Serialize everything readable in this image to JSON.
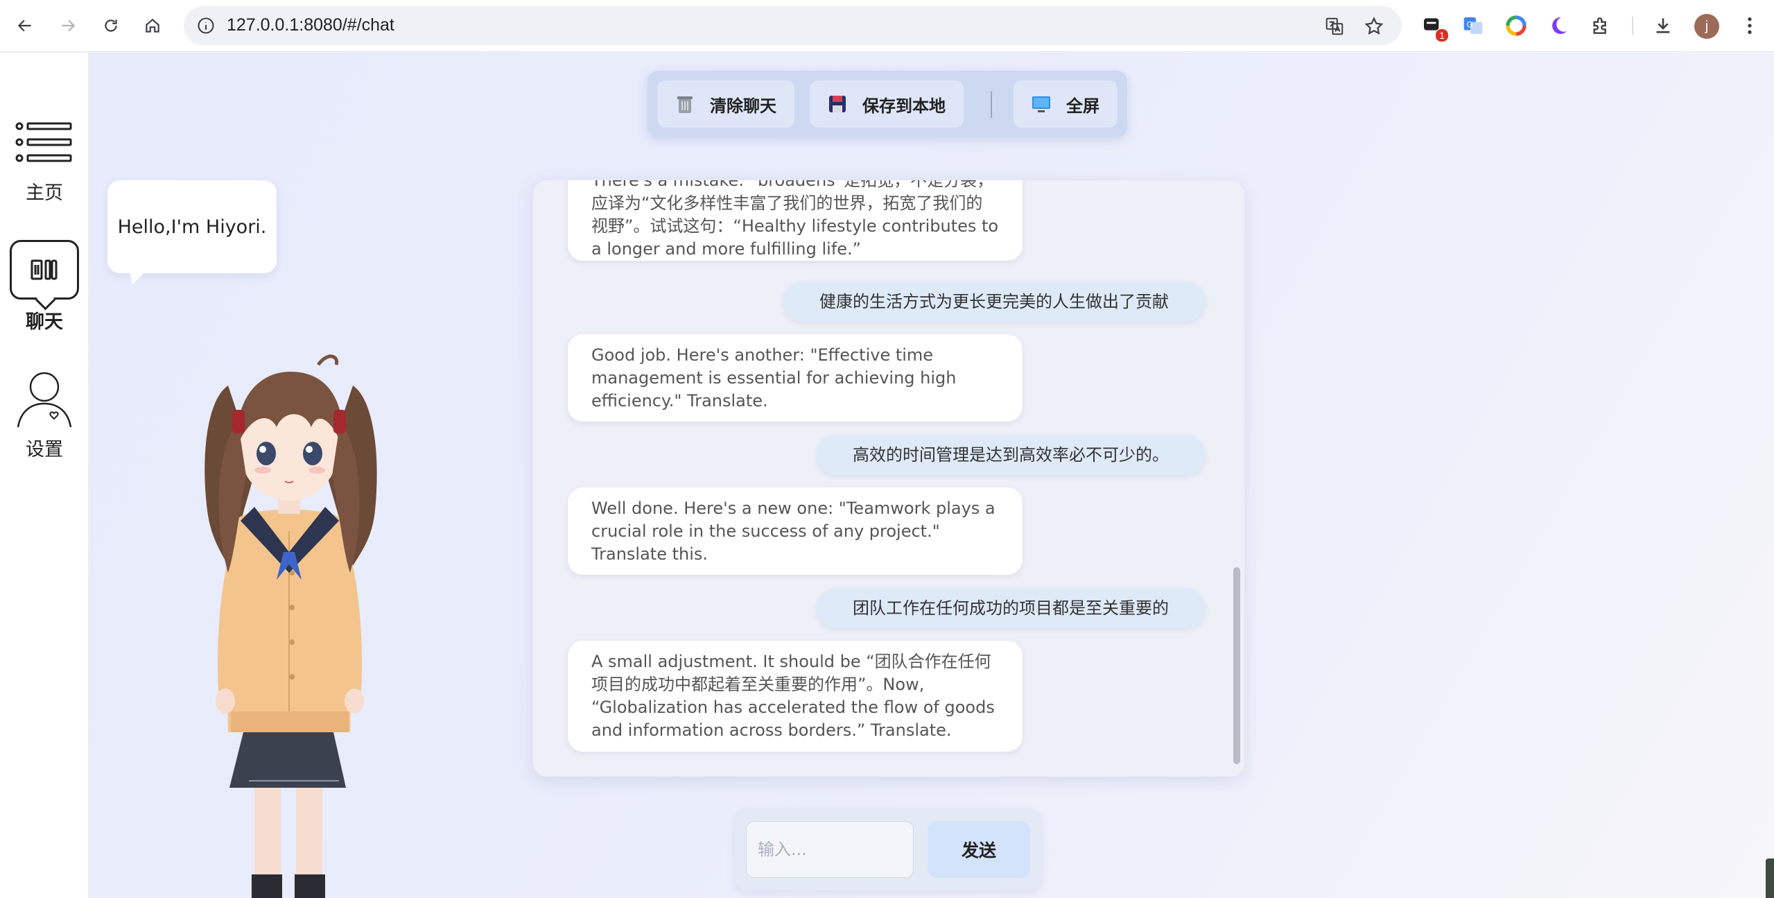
{
  "browser": {
    "url": "127.0.0.1:8080/#/chat",
    "extension_badge": "1",
    "profile_initial": "j"
  },
  "sidebar": {
    "items": [
      {
        "label": "主页",
        "icon": "list-icon"
      },
      {
        "label": "聊天",
        "icon": "chat-icon",
        "active": true
      },
      {
        "label": "设置",
        "icon": "user-icon"
      }
    ]
  },
  "toolbar": {
    "clear_label": "清除聊天",
    "save_label": "保存到本地",
    "fullscreen_label": "全屏"
  },
  "speech_bubble": "Hello,I'm Hiyori.",
  "messages": [
    {
      "role": "bot",
      "text": "There's a mistake. “broadens”是拓宽，不是分裂，应译为“文化多样性丰富了我们的世界，拓宽了我们的视野”。试试这句：“Healthy lifestyle contributes to a longer and more fulfilling life.”"
    },
    {
      "role": "user",
      "text": "健康的生活方式为更长更完美的人生做出了贡献"
    },
    {
      "role": "bot",
      "text": "Good job. Here's another: \"Effective time management is essential for achieving high efficiency.\" Translate."
    },
    {
      "role": "user",
      "text": "高效的时间管理是达到高效率必不可少的。"
    },
    {
      "role": "bot",
      "text": "Well done. Here's a new one: \"Teamwork plays a crucial role in the success of any project.\" Translate this."
    },
    {
      "role": "user",
      "text": "团队工作在任何成功的项目都是至关重要的"
    },
    {
      "role": "bot",
      "text": "A small adjustment. It should be “团队合作在任何项目的成功中都起着至关重要的作用”。Now, “Globalization has accelerated the flow of goods and information across borders.” Translate."
    }
  ],
  "input": {
    "placeholder": "输入...",
    "value": "",
    "send_label": "发送"
  },
  "colors": {
    "accent": "#d3e3fb",
    "user_bubble": "#dfeaf8",
    "toolbar_bg": "#cdd8f1"
  }
}
